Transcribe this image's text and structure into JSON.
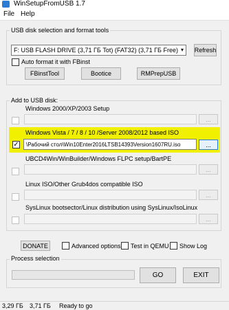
{
  "window": {
    "title": "WinSetupFromUSB 1.7"
  },
  "menu": {
    "items": [
      "File",
      "Help"
    ]
  },
  "usb_section": {
    "label": "USB disk selection and format tools",
    "drive": "F: USB FLASH DRIVE (3,71 ГБ Tot) (FAT32) (3,71 ГБ Free)",
    "refresh": "Refresh",
    "auto_format": "Auto format it with FBinst",
    "tools": [
      "FBinstTool",
      "Bootice",
      "RMPrepUSB"
    ]
  },
  "add_section": {
    "label": "Add to USB disk:",
    "options": [
      {
        "label": "Windows 2000/XP/2003 Setup",
        "path": "",
        "checked": false,
        "highlighted": false
      },
      {
        "label": "Windows Vista / 7 / 8 / 10 /Server 2008/2012 based ISO",
        "path": "\\Рабочий стол\\Win10Enter2016LTSB14393Version1607RU.iso",
        "checked": true,
        "highlighted": true
      },
      {
        "label": "UBCD4Win/WinBuilder/Windows FLPC setup/BartPE",
        "path": "",
        "checked": false,
        "highlighted": false
      },
      {
        "label": "Linux ISO/Other Grub4dos compatible ISO",
        "path": "",
        "checked": false,
        "highlighted": false
      },
      {
        "label": "SysLinux bootsector/Linux distribution using SysLinux/IsoLinux",
        "path": "",
        "checked": false,
        "highlighted": false
      }
    ],
    "browse": "...",
    "check_mark": "✓"
  },
  "bottom": {
    "donate": "DONATE",
    "advanced": "Advanced options",
    "qemu": "Test in QEMU",
    "showlog": "Show Log",
    "process_label": "Process selection",
    "go": "GO",
    "exit": "EXIT"
  },
  "status": {
    "a": "3,29 ГБ",
    "b": "3,71 ГБ",
    "c": "Ready to go"
  }
}
